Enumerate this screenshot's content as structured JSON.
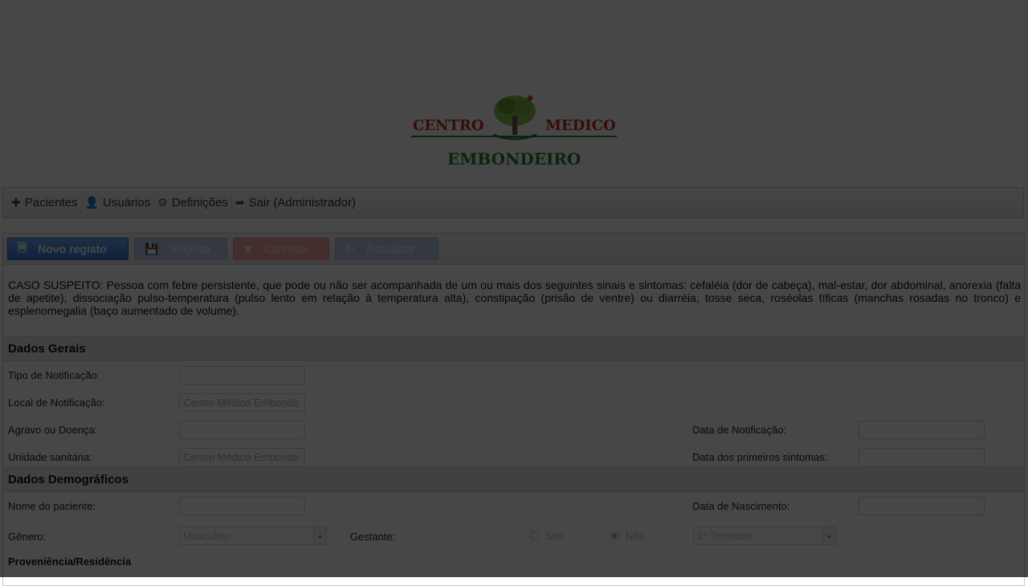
{
  "logo": {
    "word_left": "CENTRO",
    "word_right": "MEDICO",
    "word_bottom": "EMBONDEIRO"
  },
  "menu": [
    {
      "icon": "plus-icon",
      "glyph": "✚",
      "label": "Pacientes"
    },
    {
      "icon": "user-icon",
      "glyph": "👤",
      "label": "Usuários"
    },
    {
      "icon": "gear-icon",
      "glyph": "⚙",
      "label": "Definições"
    },
    {
      "icon": "sign-out-icon",
      "glyph": "➦",
      "label": "Sair (Administrador)"
    }
  ],
  "toolbar": {
    "new_label": "Novo registo",
    "register_label": "Registar",
    "cancel_label": "Cancelar",
    "update_label": "Actualizar"
  },
  "description": "CASO SUSPEITO: Pessoa com febre persistente, que pode ou não ser acompanhada de um ou mais dos seguintes sinais e sintomas: cefaléia (dor de cabeça), mal-estar, dor abdominal, anorexia (falta de apetite), dissociação pulso-temperatura (pulso lento em relação à temperatura alta), constipação (prisão de ventre) ou diarréia, tosse seca, roséolas tíficas (manchas rosadas no tronco) e esplenomegalia (baço aumentado de volume).",
  "sections": {
    "general": {
      "title": "Dados Gerais",
      "tipo_notificacao": {
        "label": "Tipo de Notificação:",
        "value": ""
      },
      "local_notificacao": {
        "label": "Local de Notificação:",
        "value": "Centro Médico Embonde"
      },
      "agravo": {
        "label": "Agravo ou Doença:",
        "value": ""
      },
      "data_notificacao": {
        "label": "Data de Notificação:",
        "value": ""
      },
      "unidade": {
        "label": "Unidade sanitária:",
        "value": "Centro Médico Embonde"
      },
      "data_sintomas": {
        "label": "Data dos primeiros sintomas:",
        "value": ""
      }
    },
    "demographic": {
      "title": "Dados Demográficos",
      "nome": {
        "label": "Nome do paciente:",
        "value": ""
      },
      "nascimento": {
        "label": "Data de Nascimento:",
        "value": ""
      },
      "genero": {
        "label": "Gênero:",
        "selected": "Masculino"
      },
      "gestante": {
        "label": "Gestante:",
        "option_yes": "Sim",
        "option_no": "Não",
        "selected": "Não"
      },
      "trimestre": {
        "selected": "1º Trimestre"
      },
      "proveniencia": "Proveniência/Residência"
    }
  },
  "colors": {
    "overlay": "#000000",
    "primary_button": "#3a77d8",
    "cancel_button": "#f0a3a3",
    "logo_red": "#c62828",
    "logo_green": "#2e7d32"
  }
}
